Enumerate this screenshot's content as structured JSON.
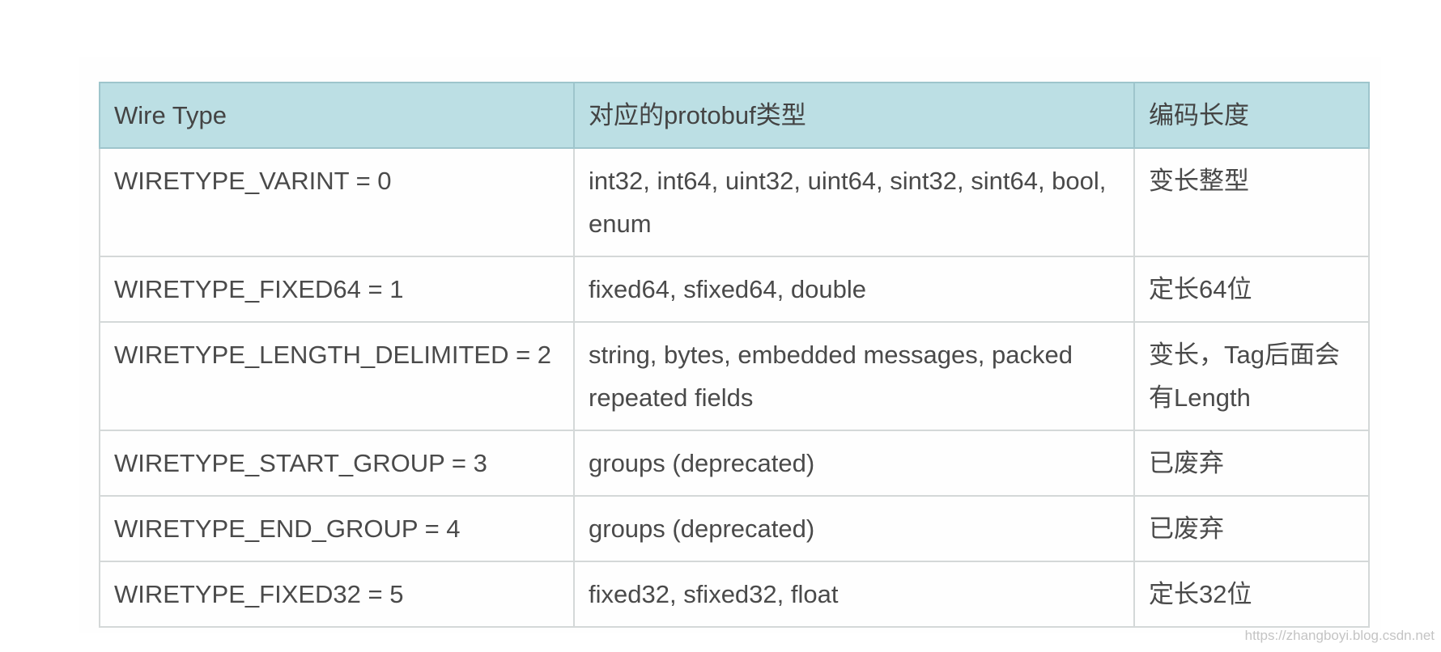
{
  "table": {
    "headers": [
      "Wire Type",
      "对应的protobuf类型",
      "编码长度"
    ],
    "rows": [
      [
        "WIRETYPE_VARINT = 0",
        "int32, int64, uint32, uint64, sint32, sint64, bool, enum",
        "变长整型"
      ],
      [
        "WIRETYPE_FIXED64 = 1",
        "fixed64, sfixed64, double",
        "定长64位"
      ],
      [
        "WIRETYPE_LENGTH_DELIMITED = 2",
        "string, bytes, embedded messages, packed repeated fields",
        "变长，Tag后面会有Length"
      ],
      [
        "WIRETYPE_START_GROUP = 3",
        "groups (deprecated)",
        "已废弃"
      ],
      [
        "WIRETYPE_END_GROUP = 4",
        "groups (deprecated)",
        "已废弃"
      ],
      [
        "WIRETYPE_FIXED32 = 5",
        "fixed32, sfixed32, float",
        "定长32位"
      ]
    ]
  },
  "watermark": "https://zhangboyi.blog.csdn.net",
  "colors": {
    "header_bg": "#bcdfe4",
    "border": "#d4d8d8",
    "text": "#4a4a4a"
  }
}
